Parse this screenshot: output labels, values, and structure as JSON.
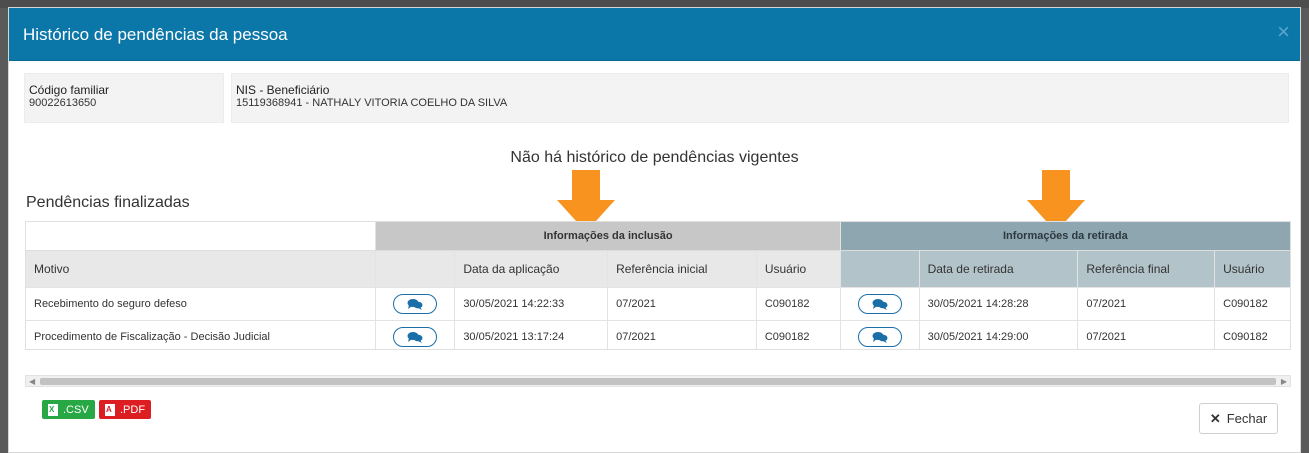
{
  "modal": {
    "title": "Histórico de pendências da pessoa",
    "close_glyph": "×"
  },
  "info": {
    "codigo_label": "Código familiar",
    "codigo_value": "90022613650",
    "nis_label": "NIS - Beneficiário",
    "nis_value": "15119368941 - NATHALY VITORIA COELHO DA SILVA"
  },
  "no_history_text": "Não há histórico de pendências vigentes",
  "section_title": "Pendências finalizadas",
  "table": {
    "group_inclusao": "Informações da inclusão",
    "group_retirada": "Informações da retirada",
    "headers": [
      "Motivo",
      "",
      "Data da aplicação",
      "Referência inicial",
      "Usuário",
      "",
      "Data de retirada",
      "Referência final",
      "Usuário"
    ],
    "rows": [
      {
        "motivo": "Recebimento do seguro defeso",
        "data_aplicacao": "30/05/2021 14:22:33",
        "ref_inicial": "07/2021",
        "usuario_inc": "C090182",
        "data_retirada": "30/05/2021 14:28:28",
        "ref_final": "07/2021",
        "usuario_ret": "C090182"
      },
      {
        "motivo": "Procedimento de Fiscalização - Decisão Judicial",
        "data_aplicacao": "30/05/2021 13:17:24",
        "ref_inicial": "07/2021",
        "usuario_inc": "C090182",
        "data_retirada": "30/05/2021 14:29:00",
        "ref_final": "07/2021",
        "usuario_ret": "C090182"
      }
    ]
  },
  "footer": {
    "csv_label": ".CSV",
    "pdf_label": ".PDF",
    "close_label": "Fechar"
  },
  "colors": {
    "header_blue": "#0b76a8",
    "arrow_orange": "#f7931e",
    "csv_green": "#28a745",
    "pdf_red": "#dc1e22"
  },
  "icons": [
    "chat-bubble-icon",
    "excel-file-icon",
    "pdf-file-icon",
    "close-icon",
    "annotation-arrow-icon"
  ]
}
